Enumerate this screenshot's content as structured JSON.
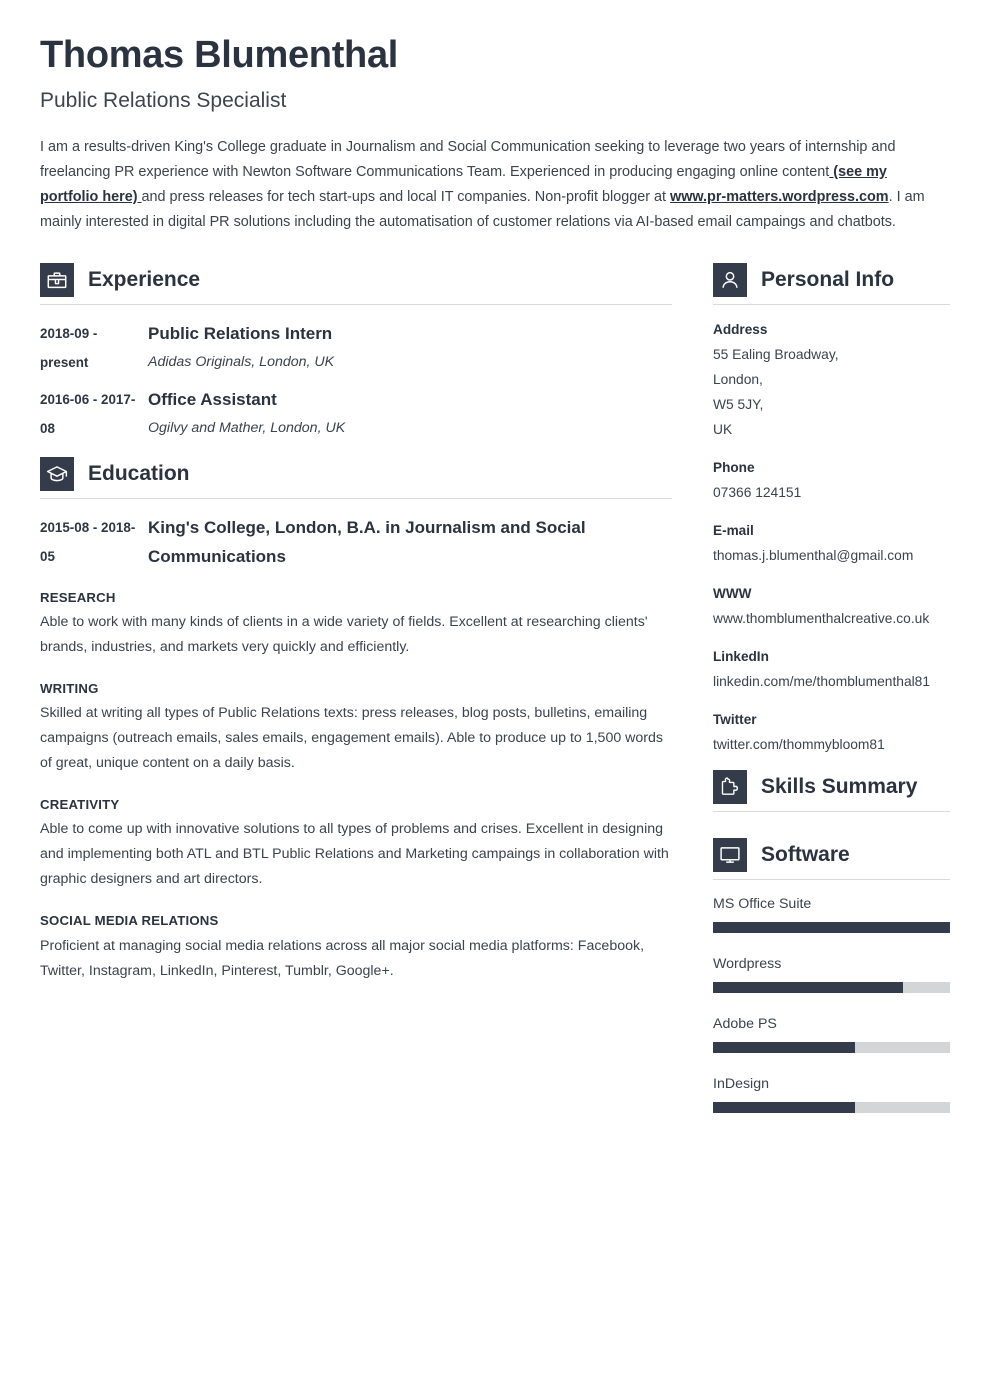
{
  "header": {
    "name": "Thomas Blumenthal",
    "job_title": "Public Relations Specialist",
    "summary_parts": [
      {
        "text": "I am a results-driven King's College graduate in Journalism and Social Communication seeking to leverage two years of internship and freelancing PR experience with Newton Software Communications Team. Experienced in producing engaging online content",
        "style": "plain"
      },
      {
        "text": " (see my portfolio here) ",
        "style": "link"
      },
      {
        "text": "and press releases for tech start-ups and local IT companies. Non-profit blogger at ",
        "style": "plain"
      },
      {
        "text": "www.pr-matters.wordpress.com",
        "style": "link"
      },
      {
        "text": ". I am mainly interested in digital PR solutions including the automatisation of customer relations via AI-based email campaings and chatbots.",
        "style": "plain"
      }
    ]
  },
  "experience": {
    "title": "Experience",
    "icon": "briefcase-icon",
    "entries": [
      {
        "dates": "2018-09 - present",
        "role": "Public Relations Intern",
        "org": "Adidas Originals, London, UK"
      },
      {
        "dates": "2016-06 - 2017-08",
        "role": "Office Assistant",
        "org": "Ogilvy and Mather, London, UK"
      }
    ]
  },
  "education": {
    "title": "Education",
    "icon": "graduation-cap-icon",
    "entries": [
      {
        "dates": "2015-08 - 2018-05",
        "role": "King's College, London, B.A. in Journalism and Social Communications",
        "org": ""
      }
    ]
  },
  "skills": [
    {
      "name": "RESEARCH",
      "description": "Able to work with many kinds of clients in a wide variety of fields. Excellent at researching clients' brands, industries, and markets very quickly and efficiently."
    },
    {
      "name": "WRITING",
      "description": "Skilled at writing all types of Public Relations texts: press releases, blog posts, bulletins, emailing campaigns (outreach emails, sales emails, engagement emails). Able to produce up to 1,500 words of great, unique content on a daily basis."
    },
    {
      "name": "CREATIVITY",
      "description": "Able to come up with innovative solutions to all types of problems and crises. Excellent in designing and implementing both ATL and BTL Public Relations and Marketing campaings in collaboration with graphic designers and art directors."
    },
    {
      "name": "SOCIAL MEDIA RELATIONS",
      "description": "Proficient at managing social media relations across all major social media platforms: Facebook, Twitter, Instagram, LinkedIn, Pinterest, Tumblr, Google+."
    }
  ],
  "personal_info": {
    "title": "Personal Info",
    "icon": "person-icon",
    "groups": [
      {
        "label": "Address",
        "lines": [
          "55 Ealing Broadway,",
          "London,",
          "W5 5JY,",
          "UK"
        ]
      },
      {
        "label": "Phone",
        "lines": [
          "07366 124151"
        ]
      },
      {
        "label": "E-mail",
        "lines": [
          "thomas.j.blumenthal@gmail.com"
        ]
      },
      {
        "label": "WWW",
        "lines": [
          "www.thomblumenthalcreative.co.uk"
        ]
      },
      {
        "label": "LinkedIn",
        "lines": [
          "linkedin.com/me/thomblumenthal81"
        ]
      },
      {
        "label": "Twitter",
        "lines": [
          "twitter.com/thommybloom81"
        ]
      }
    ]
  },
  "skills_summary": {
    "title": "Skills Summary",
    "icon": "puzzle-piece-icon"
  },
  "software": {
    "title": "Software",
    "icon": "monitor-icon",
    "items": [
      {
        "label": "MS Office Suite",
        "level": 100
      },
      {
        "label": "Wordpress",
        "level": 80
      },
      {
        "label": "Adobe PS",
        "level": 60
      },
      {
        "label": "InDesign",
        "level": 60
      }
    ]
  },
  "colors": {
    "accent_dark": "#343b4a",
    "heading": "#2b3240",
    "body_text": "#3c424e",
    "rule": "#d8dade",
    "track": "#d3d5d7",
    "page_bg": "#ffffff"
  }
}
